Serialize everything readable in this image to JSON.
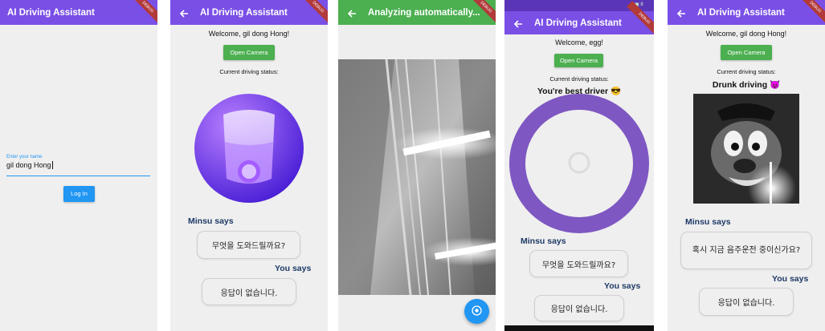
{
  "screen1": {
    "title": "AI Driving Assistant",
    "name_label": "Enter your name",
    "name_value": "gil dong Hong",
    "login_label": "Log In",
    "debug_label": "DEBUG"
  },
  "screen2": {
    "title": "AI Driving Assistant",
    "welcome": "Welcome, gil dong Hong!",
    "open_camera": "Open Camera",
    "status_label": "Current driving status:",
    "bot_name": "Minsu says",
    "bot_message": "무엇을 도와드릴까요?",
    "user_name": "You says",
    "user_message": "응답이 없습니다.",
    "debug_label": "DEBUG"
  },
  "screen3": {
    "title": "Analyzing automatically...",
    "debug_label": "DEBUG"
  },
  "screen4": {
    "status_icons": "▣ 8",
    "title": "AI Driving Assistant",
    "welcome": "Welcome, egg!",
    "open_camera": "Open Camera",
    "status_label": "Current driving status:",
    "status_value": "You're best driver 😎",
    "bot_name": "Minsu says",
    "bot_message": "무엇을 도와드릴까요?",
    "user_name": "You says",
    "user_message": "응답이 없습니다.",
    "debug_label": "DEBUG"
  },
  "screen5": {
    "title": "AI Driving Assistant",
    "welcome": "Welcome, gil dong Hong!",
    "open_camera": "Open Camera",
    "status_label": "Current driving status:",
    "status_value": "Drunk driving 😈",
    "bot_name": "Minsu says",
    "bot_message": "혹시 지금 음주운전 중이신가요?",
    "user_name": "You says",
    "user_message": "응답이 없습니다.",
    "debug_label": "DEBUG"
  },
  "colors": {
    "appbar": "#7a4fe6",
    "button_blue": "#2196f3",
    "button_green": "#4caf50",
    "ring": "#7e57c2",
    "says_text": "#1e3a66"
  }
}
